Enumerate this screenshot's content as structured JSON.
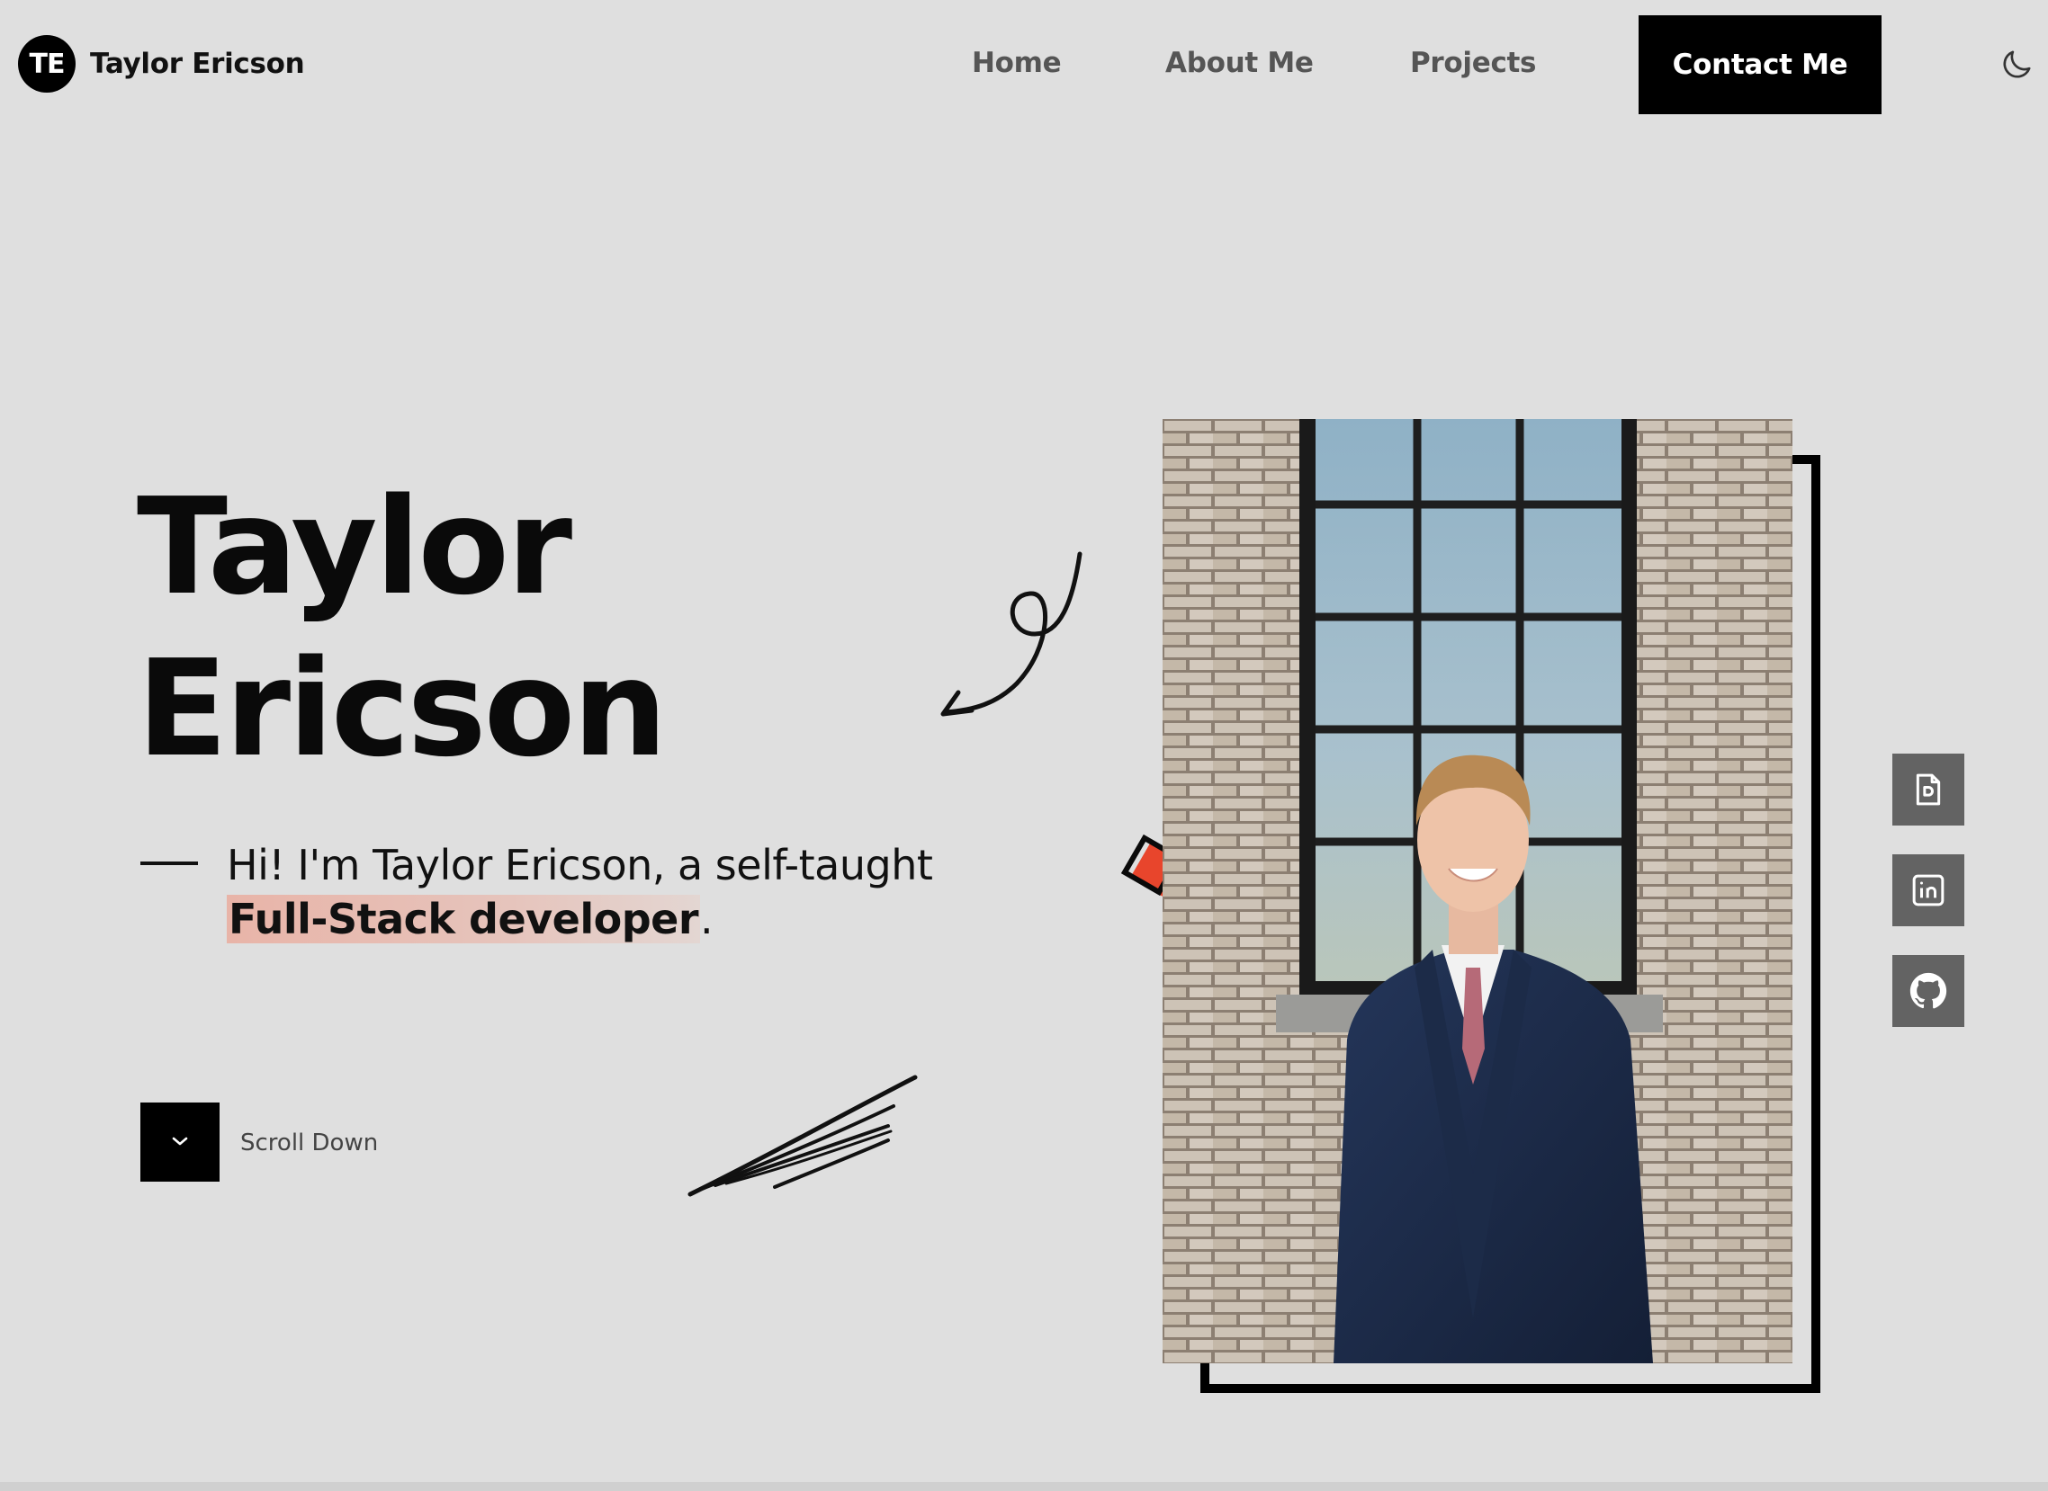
{
  "header": {
    "logo_initials": "TE",
    "logo_name": "Taylor Ericson",
    "nav": [
      "Home",
      "About Me",
      "Projects"
    ],
    "contact_label": "Contact Me",
    "theme_icon": "moon-icon"
  },
  "hero": {
    "name_line1": "Taylor",
    "name_line2": "Ericson",
    "intro_prefix": "Hi! I'm Taylor Ericson, a self-taught",
    "intro_highlight": "Full-Stack developer",
    "intro_suffix": ".",
    "scroll_label": "Scroll Down"
  },
  "socials": [
    {
      "icon": "resume-icon"
    },
    {
      "icon": "linkedin-icon"
    },
    {
      "icon": "github-icon"
    }
  ],
  "colors": {
    "background": "#dfdfdf",
    "accent": "#e8452c",
    "highlight": "#e8b4a8",
    "dark": "#000000",
    "social_bg": "#636363"
  }
}
